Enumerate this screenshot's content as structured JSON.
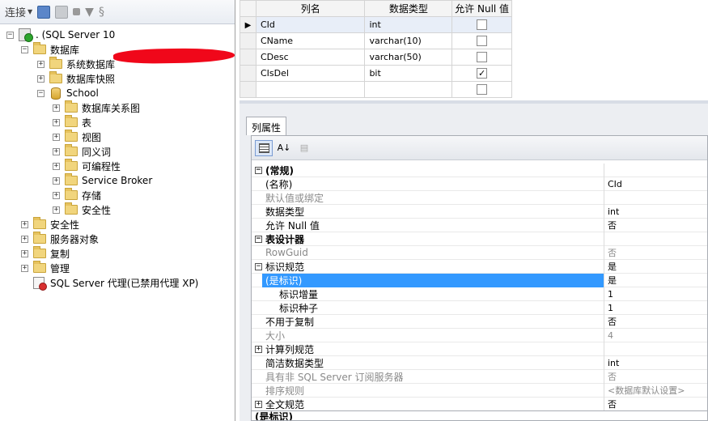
{
  "explorer": {
    "toolbar": {
      "connect_label": "连接"
    },
    "server_label": ". (SQL Server 10",
    "nodes": {
      "databases": "数据库",
      "system_databases": "系统数据库",
      "database_snapshots": "数据库快照",
      "school": "School",
      "db_diagrams": "数据库关系图",
      "tables": "表",
      "views": "视图",
      "synonyms": "同义词",
      "programmability": "可编程性",
      "service_broker": "Service Broker",
      "storage": "存储",
      "security_db": "安全性",
      "security": "安全性",
      "server_objects": "服务器对象",
      "replication": "复制",
      "management": "管理",
      "agent": "SQL Server 代理(已禁用代理 XP)"
    }
  },
  "columns_grid": {
    "headers": [
      "列名",
      "数据类型",
      "允许 Null 值"
    ],
    "rows": [
      {
        "name": "CId",
        "type": "int",
        "allow_null": false
      },
      {
        "name": "CName",
        "type": "varchar(10)",
        "allow_null": false
      },
      {
        "name": "CDesc",
        "type": "varchar(50)",
        "allow_null": false
      },
      {
        "name": "CIsDel",
        "type": "bit",
        "allow_null": true
      },
      {
        "name": "",
        "type": "",
        "allow_null": false
      }
    ]
  },
  "properties": {
    "tab_label": "列属性",
    "rows": [
      {
        "name": "(常规)",
        "value": "",
        "kind": "cat",
        "toggle": "−"
      },
      {
        "name": "(名称)",
        "value": "CId"
      },
      {
        "name": "默认值或绑定",
        "value": "",
        "kind": "gray"
      },
      {
        "name": "数据类型",
        "value": "int"
      },
      {
        "name": "允许 Null 值",
        "value": "否"
      },
      {
        "name": "表设计器",
        "value": "",
        "kind": "cat",
        "toggle": "−"
      },
      {
        "name": "RowGuid",
        "value": "否",
        "kind": "gray"
      },
      {
        "name": "标识规范",
        "value": "是",
        "toggle": "−"
      },
      {
        "name": "(是标识)",
        "value": "是",
        "kind": "selected"
      },
      {
        "name": "标识增量",
        "value": "1",
        "kind": "indent2"
      },
      {
        "name": "标识种子",
        "value": "1",
        "kind": "indent2"
      },
      {
        "name": "不用于复制",
        "value": "否"
      },
      {
        "name": "大小",
        "value": "4",
        "kind": "gray"
      },
      {
        "name": "计算列规范",
        "value": "",
        "toggle": "+"
      },
      {
        "name": "简洁数据类型",
        "value": "int"
      },
      {
        "name": "具有非 SQL Server 订阅服务器",
        "value": "否",
        "kind": "gray"
      },
      {
        "name": "排序规则",
        "value": "<数据库默认设置>",
        "kind": "gray"
      },
      {
        "name": "全文规范",
        "value": "否",
        "toggle": "+"
      }
    ],
    "description_title": "(是标识)"
  },
  "icons": {
    "connect_dropdown": "chevron-down-icon",
    "check": "✓"
  }
}
